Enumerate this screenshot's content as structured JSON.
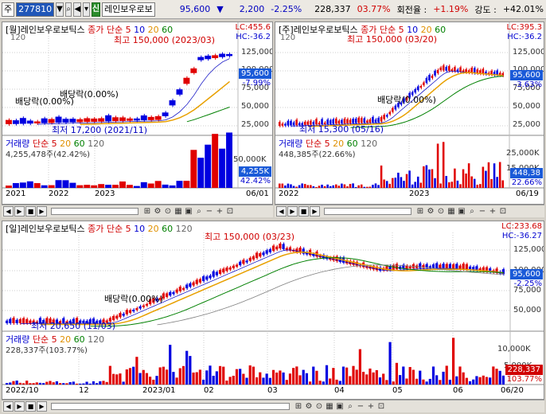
{
  "toolbar": {
    "market": "주",
    "code": "277810",
    "name": "레인보우로보",
    "sin_label": "신",
    "price": "95,600",
    "change": "2,200",
    "change_pct": "-2.25%",
    "volume": "228,337",
    "vol_pct": "03.77%",
    "turnover_label": "회전율 :",
    "turnover": "+1.19%",
    "strength_label": "강도 :",
    "strength": "+42.01%"
  },
  "monthly": {
    "title": "[월]레인보우로보틱스",
    "ma_label": "종가 단순",
    "ma": [
      "5",
      "10",
      "20",
      "60"
    ],
    "scale_top": "120",
    "lc": "LC:455.6",
    "hc": "HC:-36.2",
    "y_ticks": [
      "125,000",
      "100,000",
      "75,000",
      "50,000",
      "25,000"
    ],
    "price_tag": "95,600",
    "change_pct": "-7.99%",
    "high": "최고 150,000 (2023/03)",
    "low": "최저 17,200 (2021/11)",
    "dividend1": "배당락(0.00%)",
    "dividend2": "배당락(0.00%)",
    "vol_title": "거래량",
    "vol_ma": [
      "5",
      "20",
      "60",
      "120"
    ],
    "vol_value": "4,255,478주(42.42%)",
    "vol_tick": "50,000K",
    "vol_tag": "4,255K",
    "vol_pct": "42.42%",
    "dates": [
      "2021",
      "2022",
      "2023",
      "06/01"
    ]
  },
  "weekly": {
    "title": "[주]레인보우로보틱스",
    "ma_label": "종가 단순",
    "ma": [
      "5",
      "10",
      "20",
      "60"
    ],
    "scale_top": "120",
    "lc": "LC:395.3",
    "hc": "HC:-36.2",
    "y_ticks": [
      "125,000",
      "100,000",
      "75,000",
      "50,000",
      "25,000"
    ],
    "price_tag": "95,600",
    "change_pct": "-3.63%",
    "high": "최고 150,000 (03/20)",
    "low": "최저 15,300 (05/16)",
    "dividend": "배당락(0.00%)",
    "vol_title": "거래량",
    "vol_ma": [
      "5",
      "20",
      "60",
      "120"
    ],
    "vol_value": "448,385주(22.66%)",
    "vol_ticks": [
      "25,000K",
      "15,000K",
      "5,000K"
    ],
    "vol_tag": "448,38",
    "vol_pct": "22.66%",
    "dates": [
      "2022",
      "2023",
      "06/19"
    ]
  },
  "daily": {
    "title": "[일]레인보우로보틱스",
    "ma_label": "종가 단순",
    "ma": [
      "5",
      "10",
      "20",
      "60",
      "120"
    ],
    "lc": "LC:233.68",
    "hc": "HC:-36.27",
    "y_ticks": [
      "125,000",
      "100,000",
      "75,000",
      "50,000"
    ],
    "price_tag": "95,600",
    "change_pct": "-2.25%",
    "high": "최고 150,000 (03/23)",
    "low": "최저 20,650 (11/03)",
    "dividend": "배당락(0.00%)",
    "vol_title": "거래량",
    "vol_ma": [
      "5",
      "20",
      "60",
      "120"
    ],
    "vol_value": "228,337주(103.77%)",
    "vol_ticks": [
      "10,000K",
      "5,000K"
    ],
    "vol_tag": "228,337",
    "vol_pct": "103.77%",
    "dates": [
      "2022/10",
      "12",
      "2023/01",
      "02",
      "03",
      "04",
      "05",
      "06",
      "06/20"
    ]
  },
  "colors": {
    "up": "#e00000",
    "down": "#0000e0",
    "ma5": "#e00000",
    "ma10": "#0000c0",
    "ma20": "#e8a000",
    "ma60": "#008000",
    "ma120": "#808080"
  }
}
